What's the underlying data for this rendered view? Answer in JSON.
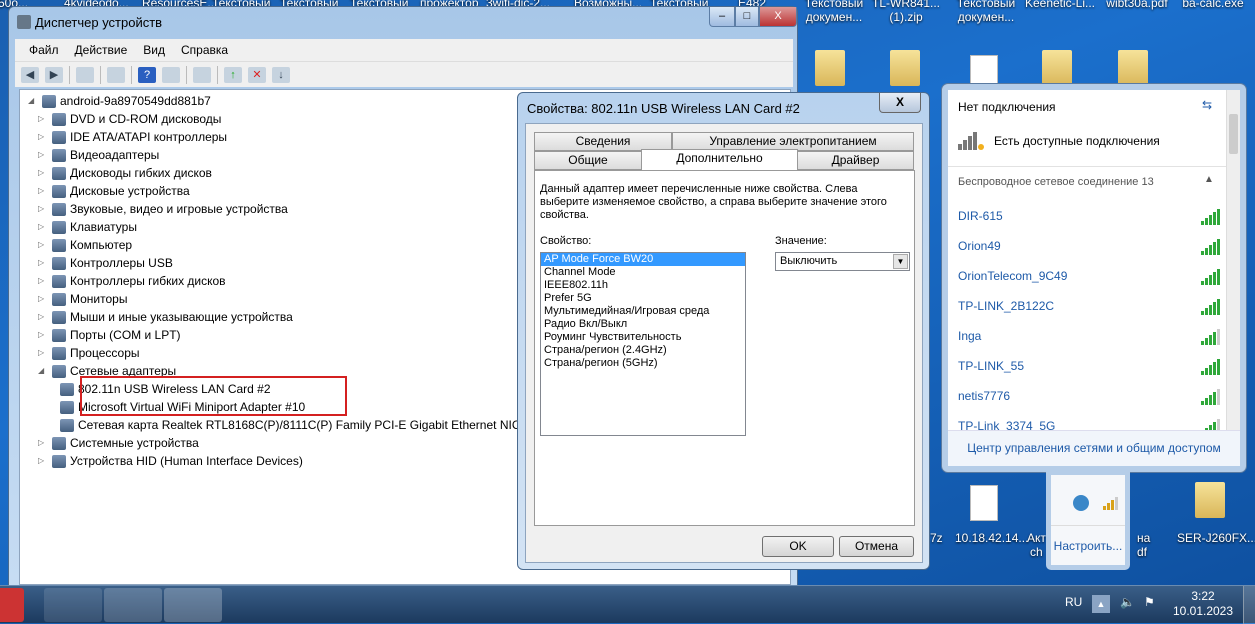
{
  "desktop": {
    "top_labels": [
      "50o...",
      "4kvideodo...",
      "ResourcesE...",
      "Текстовый",
      "Текстовый",
      "Текстовый",
      "прожектор",
      "3wifi-dic-2...",
      "Возможны...",
      "Текстовый",
      "E482"
    ],
    "right_labels": [
      [
        "Текстовый",
        "докумен..."
      ],
      [
        "TL-WR841...",
        "(1).zip"
      ],
      [
        "Текстовый",
        "докумен..."
      ],
      [
        "Keenetic-Li..."
      ],
      [
        "wibt30a.pdf"
      ],
      [
        "ba-calc.exe"
      ]
    ],
    "bottom_labels": [
      "7z",
      "10.18.42.14...",
      "Акт",
      "ch",
      "на",
      "df",
      "SER-J260FX..."
    ]
  },
  "device_manager": {
    "title": "Диспетчер устройств",
    "menu": [
      "Файл",
      "Действие",
      "Вид",
      "Справка"
    ],
    "root": "android-9a8970549dd881b7",
    "categories": [
      "DVD и CD-ROM дисководы",
      "IDE ATA/ATAPI контроллеры",
      "Видеоадаптеры",
      "Дисководы гибких дисков",
      "Дисковые устройства",
      "Звуковые, видео и игровые устройства",
      "Клавиатуры",
      "Компьютер",
      "Контроллеры USB",
      "Контроллеры гибких дисков",
      "Мониторы",
      "Мыши и иные указывающие устройства",
      "Порты (COM и LPT)",
      "Процессоры",
      "Сетевые адаптеры"
    ],
    "network_adapters": [
      "802.11n USB Wireless LAN Card #2",
      "Microsoft Virtual WiFi Miniport Adapter #10",
      "Сетевая карта Realtek RTL8168C(P)/8111C(P) Family PCI-E Gigabit Ethernet NIC"
    ],
    "categories_after": [
      "Системные устройства",
      "Устройства HID (Human Interface Devices)"
    ]
  },
  "dialog": {
    "title": "Свойства: 802.11n USB Wireless LAN Card #2",
    "close": "X",
    "tabs_row1": [
      "Сведения",
      "Управление электропитанием"
    ],
    "tabs_row2": [
      "Общие",
      "Дополнительно",
      "Драйвер"
    ],
    "description": "Данный адаптер имеет перечисленные ниже свойства. Слева выберите изменяемое свойство, а справа выберите значение этого свойства.",
    "property_label": "Свойство:",
    "value_label": "Значение:",
    "properties": [
      "AP Mode Force BW20",
      "Channel Mode",
      "IEEE802.11h",
      "Prefer 5G",
      "Мультимедийная/Игровая среда",
      "Радио Вкл/Выкл",
      "Роуминг Чувствительность",
      "Страна/регион (2.4GHz)",
      "Страна/регион (5GHz)"
    ],
    "value": "Выключить",
    "ok": "OK",
    "cancel": "Отмена"
  },
  "network": {
    "status": "Нет подключения",
    "available": "Есть доступные подключения",
    "section": "Беспроводное сетевое соединение 13",
    "networks": [
      "DIR-615",
      "Orion49",
      "OrionTelecom_9C49",
      "TP-LINK_2B122C",
      "Inga",
      "TP-LINK_55",
      "netis7776",
      "TP-Link_3374_5G"
    ],
    "footer": "Центр управления сетями и общим доступом"
  },
  "tray_popup": {
    "customize": "Настроить..."
  },
  "taskbar": {
    "lang": "RU",
    "time": "3:22",
    "date": "10.01.2023"
  }
}
